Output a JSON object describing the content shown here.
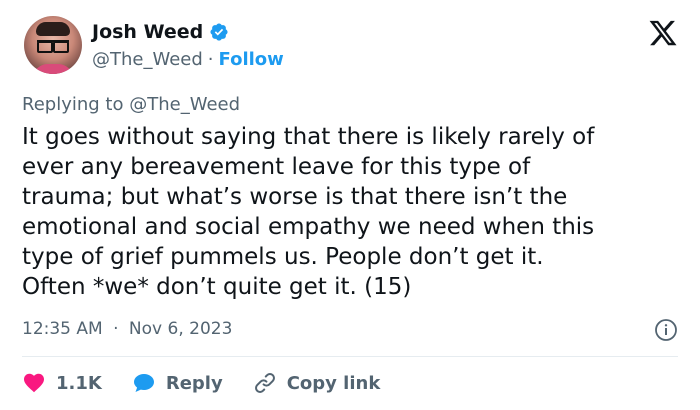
{
  "author": {
    "name": "Josh Weed",
    "handle": "@The_Weed",
    "separator": "·",
    "follow_label": "Follow"
  },
  "reply_context": {
    "prefix": "Replying to",
    "handle": "@The_Weed"
  },
  "tweet": {
    "lines": [
      "It goes without saying that there is likely rarely of",
      "ever any bereavement leave for this type of",
      "trauma; but what’s worse is that there isn’t the",
      "emotional and social empathy we need when this",
      "type of grief pummels us. People don’t get it.",
      "Often *we* don’t quite get it. (15)"
    ],
    "time": "12:35 AM",
    "separator": "·",
    "date": "Nov 6, 2023"
  },
  "actions": {
    "like_count": "1.1K",
    "reply_label": "Reply",
    "copy_link_label": "Copy link"
  },
  "colors": {
    "accent": "#1d9bf0",
    "like": "#f91880",
    "muted": "#536471",
    "text": "#0f1419"
  },
  "icons": {
    "verified": "verified-badge-icon",
    "brand": "x-logo-icon",
    "info": "info-icon",
    "like": "heart-icon",
    "reply": "speech-bubble-icon",
    "copy": "link-icon"
  }
}
